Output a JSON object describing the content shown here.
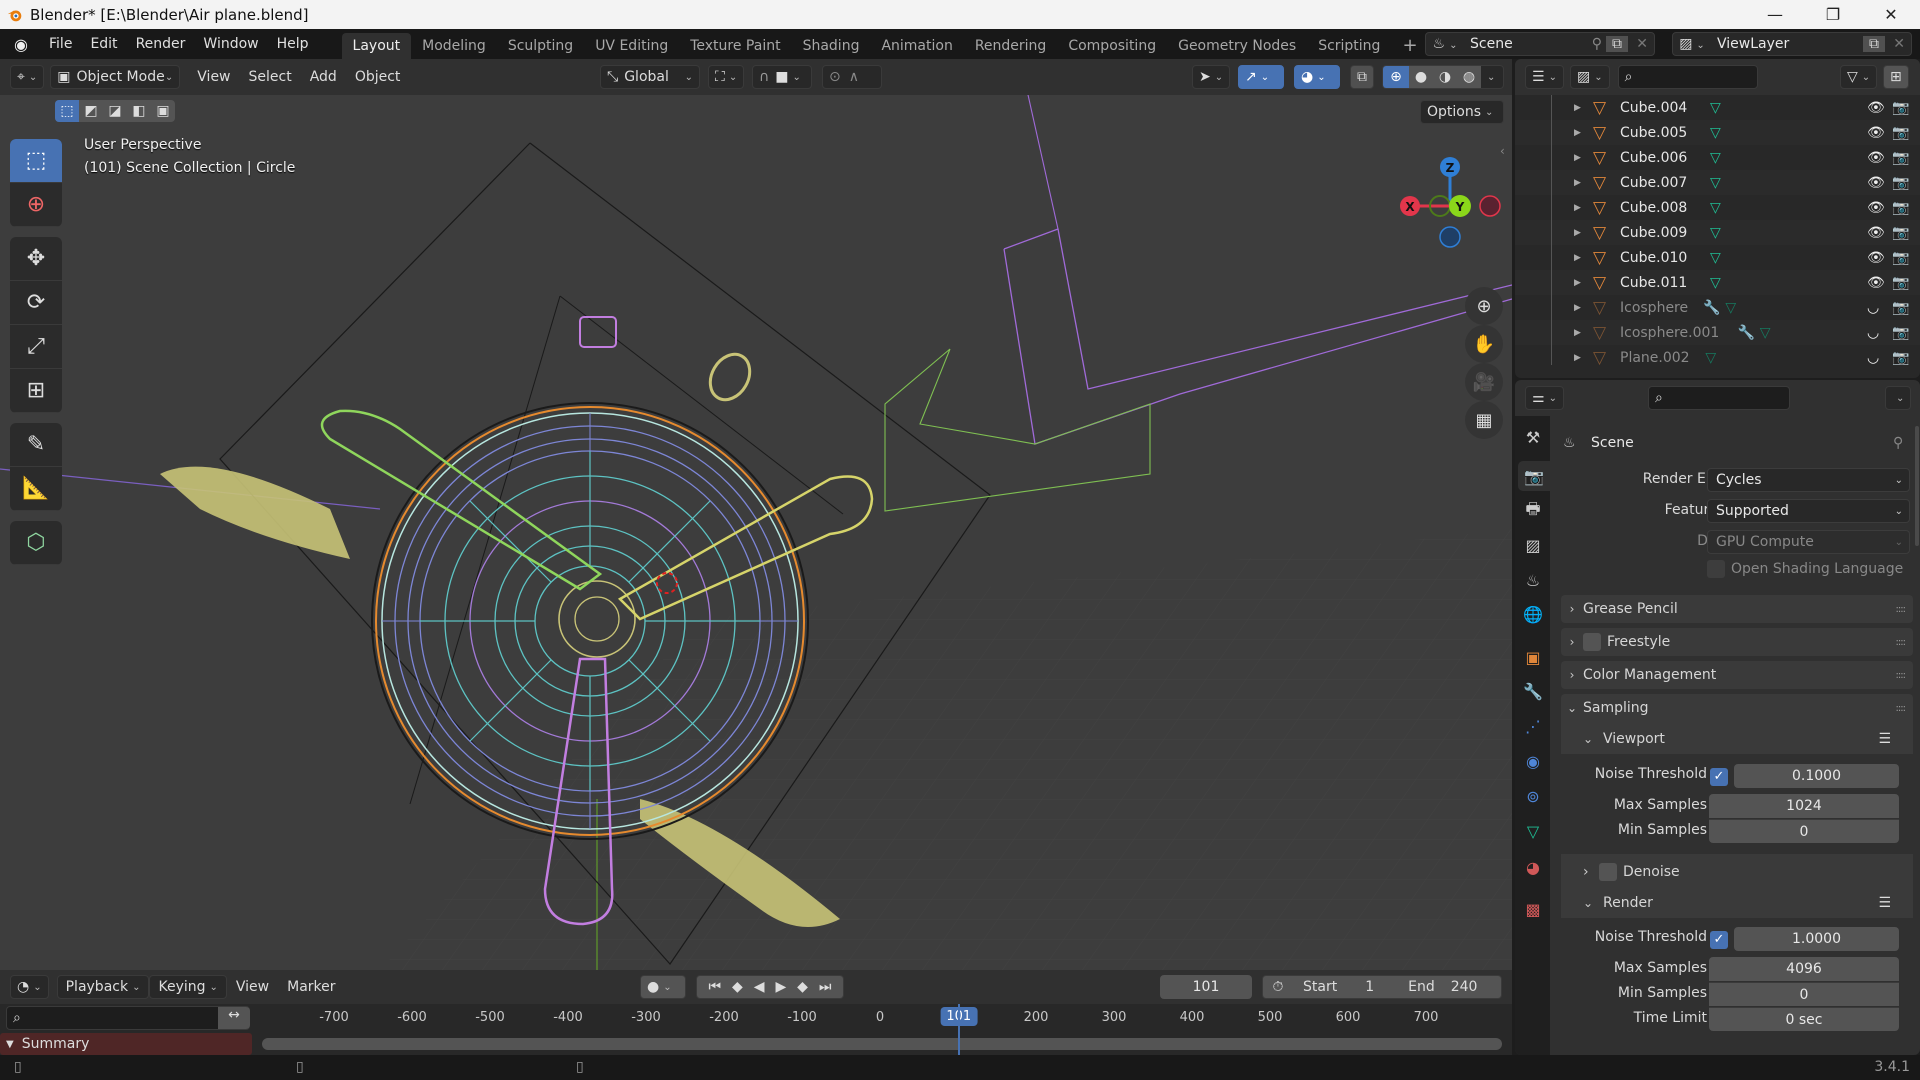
{
  "window": {
    "title": "Blender* [E:\\Blender\\Air plane.blend]",
    "controls": {
      "minimize": "—",
      "maximize": "❐",
      "close": "✕"
    }
  },
  "menubar": {
    "items": [
      "File",
      "Edit",
      "Render",
      "Window",
      "Help"
    ],
    "workspaces": [
      "Layout",
      "Modeling",
      "Sculpting",
      "UV Editing",
      "Texture Paint",
      "Shading",
      "Animation",
      "Rendering",
      "Compositing",
      "Geometry Nodes",
      "Scripting"
    ],
    "active_workspace": "Layout",
    "add_workspace": "+",
    "scene": "Scene",
    "view_layer": "ViewLayer"
  },
  "viewport": {
    "mode": "Object Mode",
    "menus": [
      "View",
      "Select",
      "Add",
      "Object"
    ],
    "orientation": "Global",
    "options_label": "Options",
    "view_name": "User Perspective",
    "collection_info": "(101) Scene Collection | Circle",
    "gizmo_axes": {
      "x": "X",
      "y": "Y",
      "z": "Z"
    },
    "shading_mode": "wireframe",
    "colors": {
      "accent": "#4772b3",
      "x_axis": "#e2364b",
      "y_axis": "#8bd61a",
      "z_axis": "#2f7fd6"
    }
  },
  "timeline": {
    "menus": [
      "Playback",
      "Keying",
      "View",
      "Marker"
    ],
    "current_frame": "101",
    "start_label": "Start",
    "start": "1",
    "end_label": "End",
    "end": "240",
    "ruler_ticks": [
      "-700",
      "-600",
      "-500",
      "-400",
      "-300",
      "-200",
      "-100",
      "0",
      "200",
      "300",
      "400",
      "500",
      "600",
      "700"
    ],
    "playhead": "101",
    "summary_label": "Summary"
  },
  "outliner": {
    "items": [
      {
        "name": "Cube.004",
        "visible": true,
        "modifier": false
      },
      {
        "name": "Cube.005",
        "visible": true,
        "modifier": false
      },
      {
        "name": "Cube.006",
        "visible": true,
        "modifier": false
      },
      {
        "name": "Cube.007",
        "visible": true,
        "modifier": false
      },
      {
        "name": "Cube.008",
        "visible": true,
        "modifier": false
      },
      {
        "name": "Cube.009",
        "visible": true,
        "modifier": false
      },
      {
        "name": "Cube.010",
        "visible": true,
        "modifier": false
      },
      {
        "name": "Cube.011",
        "visible": true,
        "modifier": false
      },
      {
        "name": "Icosphere",
        "visible": false,
        "modifier": true
      },
      {
        "name": "Icosphere.001",
        "visible": false,
        "modifier": true
      },
      {
        "name": "Plane.002",
        "visible": false,
        "modifier": false
      }
    ]
  },
  "properties": {
    "context": "Scene",
    "render_engine_label": "Render Engine",
    "render_engine": "Cycles",
    "feature_set_label": "Feature Set",
    "feature_set": "Supported",
    "device_label": "Device",
    "device": "GPU Compute",
    "osl_label": "Open Shading Language",
    "panels": {
      "grease_pencil": "Grease Pencil",
      "freestyle": "Freestyle",
      "color_management": "Color Management",
      "sampling": "Sampling",
      "viewport": "Viewport",
      "denoise": "Denoise",
      "render": "Render"
    },
    "viewport_sampling": {
      "noise_threshold_label": "Noise Threshold",
      "noise_threshold_enabled": true,
      "noise_threshold": "0.1000",
      "max_samples_label": "Max Samples",
      "max_samples": "1024",
      "min_samples_label": "Min Samples",
      "min_samples": "0"
    },
    "render_sampling": {
      "noise_threshold_label": "Noise Threshold",
      "noise_threshold_enabled": true,
      "noise_threshold": "1.0000",
      "max_samples_label": "Max Samples",
      "max_samples": "4096",
      "min_samples_label": "Min Samples",
      "min_samples": "0",
      "time_limit_label": "Time Limit",
      "time_limit": "0 sec"
    }
  },
  "statusbar": {
    "version": "3.4.1"
  }
}
